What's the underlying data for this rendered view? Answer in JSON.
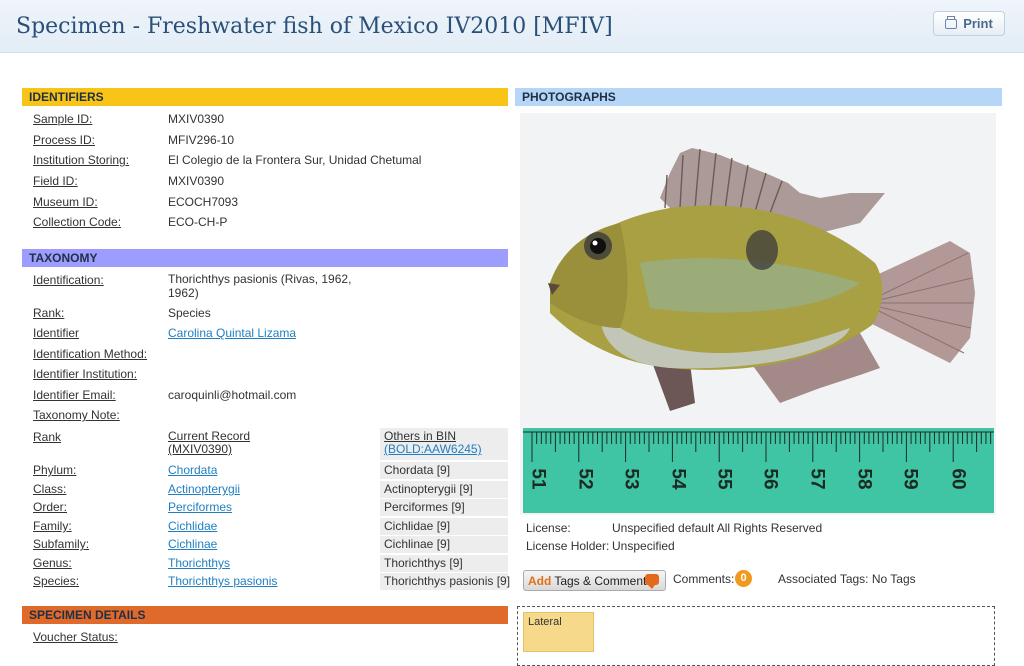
{
  "header": {
    "title": "Specimen - Freshwater fish of Mexico IV2010 [MFIV]",
    "print_label": "Print"
  },
  "identifiers": {
    "heading": "IDENTIFIERS",
    "fields": [
      {
        "label": "Sample ID:",
        "value": "MXIV0390"
      },
      {
        "label": "Process ID:",
        "value": "MFIV296-10"
      },
      {
        "label": "Institution Storing:",
        "value": "El Colegio de la Frontera Sur, Unidad Chetumal"
      },
      {
        "label": "Field ID:",
        "value": "MXIV0390"
      },
      {
        "label": "Museum ID:",
        "value": "ECOCH7093"
      },
      {
        "label": "Collection Code:",
        "value": "ECO-CH-P"
      }
    ]
  },
  "taxonomy": {
    "heading": "TAXONOMY",
    "identification_label": "Identification:",
    "identification_value": "Thorichthys pasionis (Rivas, 1962, 1962)",
    "rank_label": "Rank:",
    "rank_value": "Species",
    "identifier_label": "Identifier",
    "identifier_value": "Carolina Quintal Lizama",
    "method_label": "Identification Method:",
    "institution_label": "Identifier Institution:",
    "email_label": "Identifier Email:",
    "email_value": "caroquinli@hotmail.com",
    "note_label": "Taxonomy Note:",
    "table_header": {
      "rank": "Rank",
      "current": "Current Record",
      "current_id": "(MXIV0390)",
      "others": "Others in BIN",
      "bin": "(BOLD:AAW6245)"
    },
    "rows": [
      {
        "rank": "Phylum:",
        "current": "Chordata",
        "others": "Chordata [9]"
      },
      {
        "rank": "Class:",
        "current": "Actinopterygii",
        "others": "Actinopterygii [9]"
      },
      {
        "rank": "Order:",
        "current": "Perciformes",
        "others": "Perciformes [9]"
      },
      {
        "rank": "Family:",
        "current": "Cichlidae",
        "others": "Cichlidae [9]"
      },
      {
        "rank": "Subfamily:",
        "current": "Cichlinae",
        "others": "Cichlinae [9]"
      },
      {
        "rank": "Genus:",
        "current": "Thorichthys",
        "others": "Thorichthys [9]"
      },
      {
        "rank": "Species:",
        "current": "Thorichthys pasionis",
        "others": "Thorichthys pasionis [9]"
      }
    ]
  },
  "specimen_details": {
    "heading": "SPECIMEN DETAILS",
    "voucher_label": "Voucher Status:"
  },
  "photographs": {
    "heading": "PHOTOGRAPHS",
    "ruler_numbers": [
      "51",
      "52",
      "53",
      "54",
      "55",
      "56",
      "57",
      "58",
      "59",
      "60"
    ],
    "license_label": "License:",
    "license_value": "Unspecified default All Rights Reserved",
    "holder_label": "License Holder:",
    "holder_value": "Unspecified",
    "add_label": "Add",
    "tags_label": "Tags & Comments",
    "comments_label": "Comments:",
    "comments_count": "0",
    "associated_tags": "Associated Tags: No Tags",
    "thumb_label": "Lateral"
  },
  "colors": {
    "identifiers_bar": "#f8c417",
    "taxonomy_bar": "#9d9dff",
    "specimen_bar": "#df6a2c",
    "photographs_bar": "#b5d6f7",
    "link": "#1f7fc2"
  }
}
